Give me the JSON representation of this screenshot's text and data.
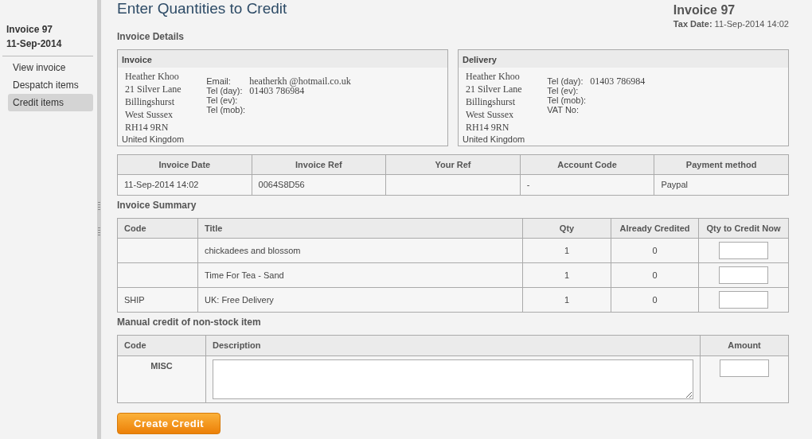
{
  "sidebar": {
    "title": "Invoice 97",
    "date": "11-Sep-2014",
    "items": [
      {
        "label": "View invoice",
        "selected": false
      },
      {
        "label": "Despatch items",
        "selected": false
      },
      {
        "label": "Credit items",
        "selected": true
      }
    ]
  },
  "header": {
    "title": "Enter Quantities to Credit",
    "invoice_number": "Invoice 97",
    "tax_date_label": "Tax Date:",
    "tax_date": "11-Sep-2014 14:02"
  },
  "details_heading": "Invoice Details",
  "address_boxes": [
    {
      "heading": "Invoice",
      "lines": [
        "Heather Khoo",
        "21 Silver Lane",
        "Billingshurst",
        "West Sussex",
        "RH14 9RN"
      ],
      "country": "United Kingdom",
      "contacts": [
        {
          "label": "Email:",
          "value": "heatherkh @hotmail.co.uk"
        },
        {
          "label": "Tel (day):",
          "value": "01403 786984"
        },
        {
          "label": "Tel (ev):"
        },
        {
          "label": "Tel (mob):"
        }
      ]
    },
    {
      "heading": "Delivery",
      "lines": [
        "Heather Khoo",
        "21 Silver Lane",
        "Billingshurst",
        "West Sussex",
        "RH14 9RN"
      ],
      "country": "United Kingdom",
      "contacts": [
        {
          "label": "Tel (day):",
          "value": "01403 786984"
        },
        {
          "label": "Tel (ev):"
        },
        {
          "label": "Tel (mob):"
        },
        {
          "label": "VAT No:"
        }
      ]
    }
  ],
  "details_table": {
    "columns": [
      "Invoice Date",
      "Invoice Ref",
      "Your Ref",
      "Account Code",
      "Payment method"
    ],
    "row": {
      "invoice_date": "11-Sep-2014 14:02",
      "invoice_ref": "0064S8D56",
      "account_code": "-",
      "payment_method": "Paypal"
    }
  },
  "summary": {
    "heading": "Invoice Summary",
    "columns": [
      "Code",
      "Title",
      "Qty",
      "Already Credited",
      "Qty to Credit Now"
    ],
    "rows": [
      {
        "title": "chickadees and blossom",
        "qty": "1",
        "already_credited": "0"
      },
      {
        "title": "Time For Tea - Sand",
        "qty": "1",
        "already_credited": "0"
      },
      {
        "code": "SHIP",
        "title": "UK: Free Delivery",
        "qty": "1",
        "already_credited": "0"
      }
    ]
  },
  "manual": {
    "heading": "Manual credit of non-stock item",
    "columns": [
      "Code",
      "Description",
      "Amount"
    ],
    "rows": [
      {
        "code": "MISC"
      }
    ]
  },
  "submit_button": "Create Credit"
}
